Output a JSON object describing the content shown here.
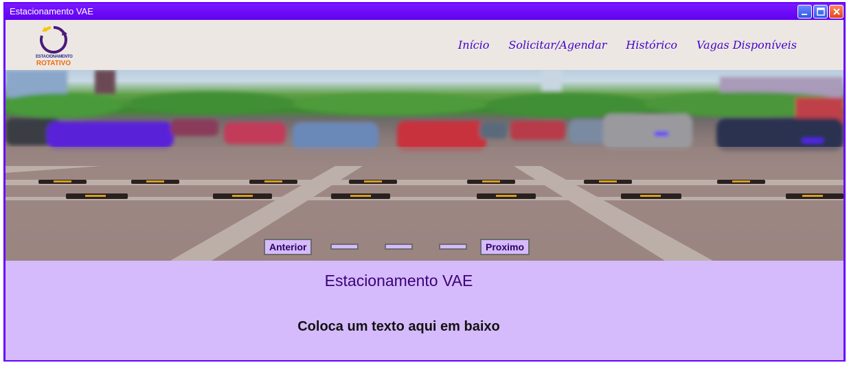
{
  "window": {
    "title": "Estacionamento VAE"
  },
  "logo": {
    "line1": "ESTACIONAMENTO",
    "line2": "ROTATIVO"
  },
  "nav": {
    "items": [
      {
        "label": "Início"
      },
      {
        "label": "Solicitar/Agendar"
      },
      {
        "label": "Histórico"
      },
      {
        "label": "Vagas Disponíveis"
      }
    ]
  },
  "carousel": {
    "prev_label": "Anterior",
    "next_label": "Proximo",
    "slide_count": 3
  },
  "content": {
    "title": "Estacionamento VAE",
    "text": "Coloca um texto aqui em baixo"
  },
  "colors": {
    "accent": "#6600ff",
    "content_bg": "#d5bbfb",
    "navbar_bg": "#ece7e2",
    "nav_link": "#4400cc"
  }
}
